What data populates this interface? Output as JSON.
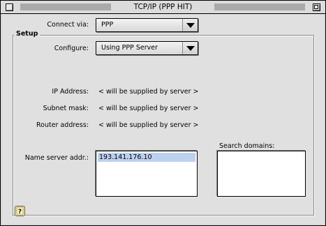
{
  "window": {
    "title": "TCP/IP (PPP HIT)"
  },
  "connect": {
    "label": "Connect via:",
    "value": "PPP"
  },
  "setup": {
    "group_label": "Setup",
    "configure_label": "Configure:",
    "configure_value": "Using PPP Server",
    "ip_label": "IP Address:",
    "ip_value": "< will be supplied by server >",
    "subnet_label": "Subnet mask:",
    "subnet_value": "< will be supplied by server >",
    "router_label": "Router address:",
    "router_value": "< will be supplied by server >",
    "nameserver_label": "Name server addr.:",
    "nameservers": [
      "193.141.176.10"
    ],
    "search_label": "Search domains:",
    "search_domains": []
  },
  "icons": {
    "close": "close-box-icon",
    "zoom": "zoom-box-icon",
    "help": "help-icon"
  }
}
